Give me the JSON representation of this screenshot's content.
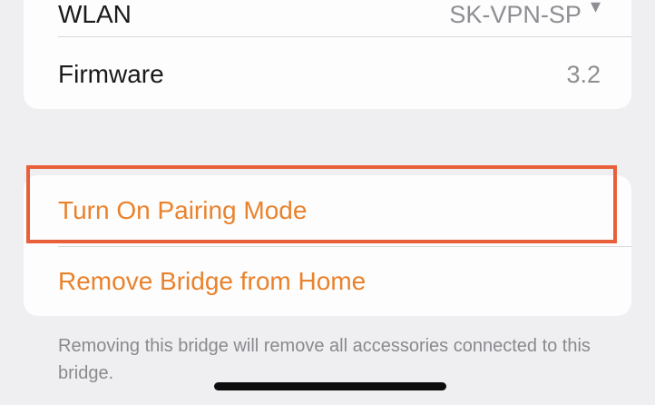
{
  "info_card": {
    "wlan_label": "WLAN",
    "wlan_value": "SK-VPN-SP",
    "firmware_label": "Firmware",
    "firmware_value": "3.2"
  },
  "actions": {
    "pairing_label": "Turn On Pairing Mode",
    "remove_label": "Remove Bridge from Home"
  },
  "footer": {
    "note": "Removing this bridge will remove all accessories connected to this bridge."
  },
  "colors": {
    "accent": "#e9822c",
    "highlight": "#e8603a",
    "background": "#efeff1",
    "card": "#fdfdfd"
  }
}
